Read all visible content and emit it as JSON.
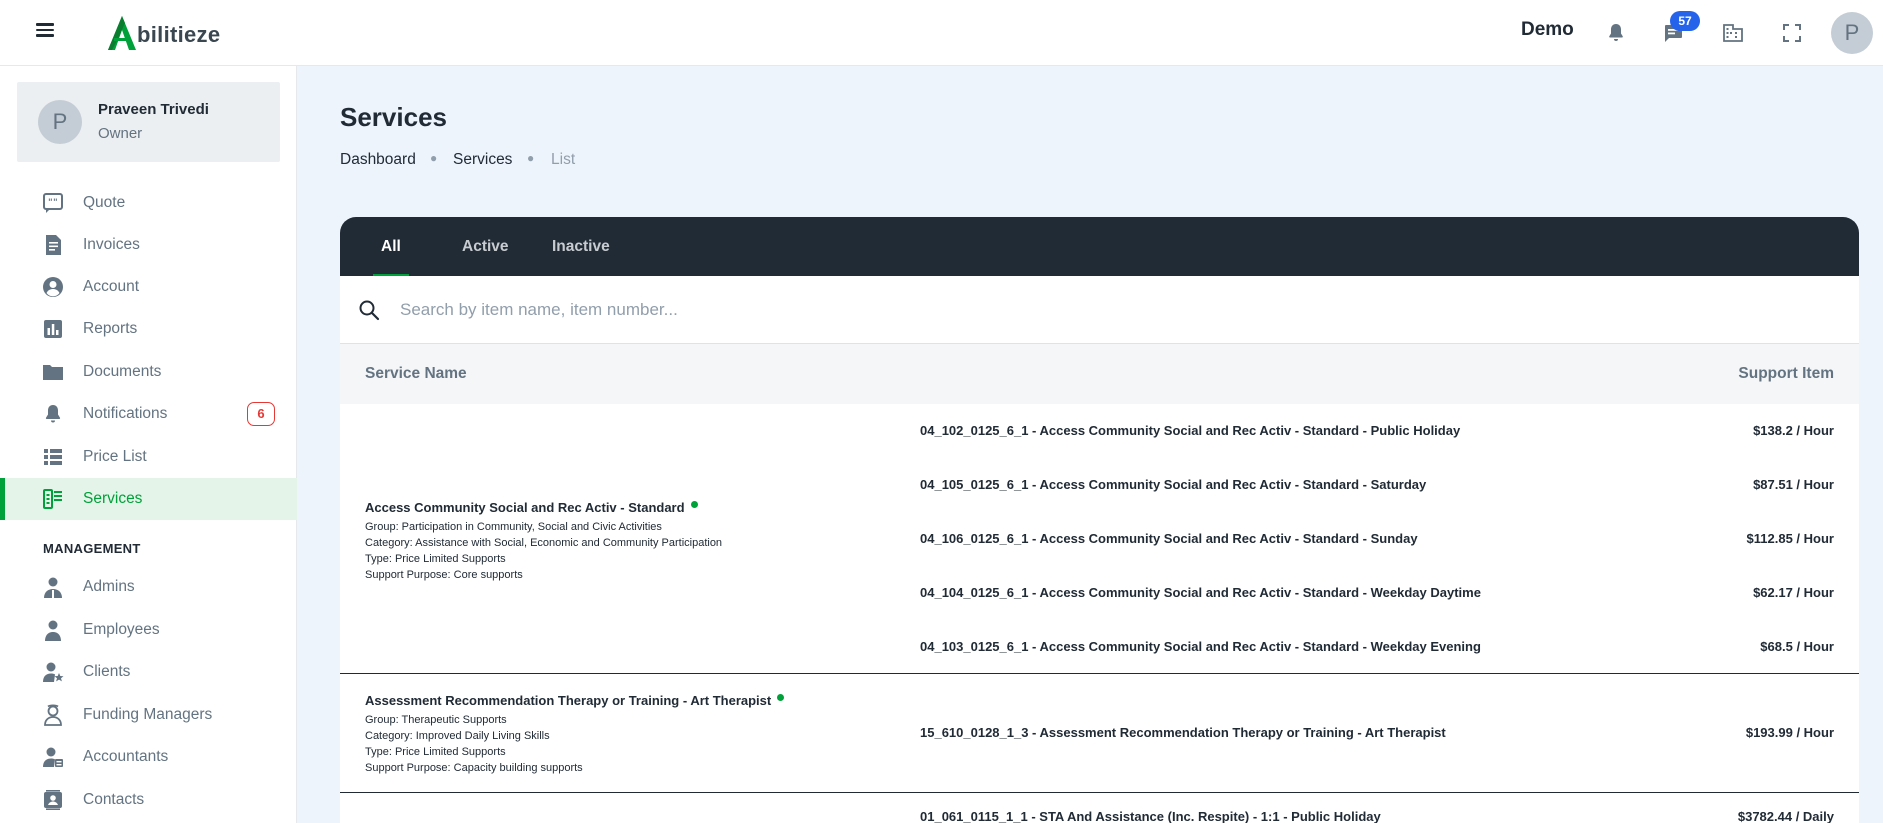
{
  "header": {
    "logo_text": "bilitieze",
    "logo_letter": "A",
    "org_name": "Demo",
    "messages_badge": "57",
    "avatar_initial": "P"
  },
  "sidebar": {
    "user": {
      "initial": "P",
      "name": "Praveen Trivedi",
      "role": "Owner"
    },
    "items": [
      {
        "label": "Quote",
        "icon": "quote-icon"
      },
      {
        "label": "Invoices",
        "icon": "invoice-icon"
      },
      {
        "label": "Account",
        "icon": "account-icon"
      },
      {
        "label": "Reports",
        "icon": "reports-icon"
      },
      {
        "label": "Documents",
        "icon": "folder-icon"
      },
      {
        "label": "Notifications",
        "icon": "bell-icon",
        "badge": "6"
      },
      {
        "label": "Price List",
        "icon": "list-icon"
      },
      {
        "label": "Services",
        "icon": "services-icon",
        "active": true
      }
    ],
    "section_title": "MANAGEMENT",
    "management_items": [
      {
        "label": "Admins",
        "icon": "admin-icon"
      },
      {
        "label": "Employees",
        "icon": "employee-icon"
      },
      {
        "label": "Clients",
        "icon": "client-icon"
      },
      {
        "label": "Funding Managers",
        "icon": "funding-manager-icon"
      },
      {
        "label": "Accountants",
        "icon": "accountant-icon"
      },
      {
        "label": "Contacts",
        "icon": "contacts-icon"
      }
    ]
  },
  "main": {
    "title": "Services",
    "breadcrumb": [
      "Dashboard",
      "Services",
      "List"
    ],
    "tabs": [
      "All",
      "Active",
      "Inactive"
    ],
    "search_placeholder": "Search by item name, item number...",
    "columns": {
      "service_name": "Service Name",
      "support_item": "Support Item"
    },
    "services": [
      {
        "name": "Access Community Social and Rec Activ - Standard",
        "group": "Group: Participation in Community, Social and Civic Activities",
        "category": "Category: Assistance with Social, Economic and Community Participation",
        "type": "Type: Price Limited Supports",
        "purpose": "Support Purpose: Core supports",
        "items": [
          {
            "name": "04_102_0125_6_1 - Access Community Social and Rec Activ - Standard - Public Holiday",
            "price": "$138.2 / Hour"
          },
          {
            "name": "04_105_0125_6_1 - Access Community Social and Rec Activ - Standard - Saturday",
            "price": "$87.51 / Hour"
          },
          {
            "name": "04_106_0125_6_1 - Access Community Social and Rec Activ - Standard - Sunday",
            "price": "$112.85 / Hour"
          },
          {
            "name": "04_104_0125_6_1 - Access Community Social and Rec Activ - Standard - Weekday Daytime",
            "price": "$62.17 / Hour"
          },
          {
            "name": "04_103_0125_6_1 - Access Community Social and Rec Activ - Standard - Weekday Evening",
            "price": "$68.5 / Hour"
          }
        ]
      },
      {
        "name": "Assessment Recommendation Therapy or Training - Art Therapist",
        "group": "Group: Therapeutic Supports",
        "category": "Category: Improved Daily Living Skills",
        "type": "Type: Price Limited Supports",
        "purpose": "Support Purpose: Capacity building supports",
        "items": [
          {
            "name": "15_610_0128_1_3 - Assessment Recommendation Therapy or Training - Art Therapist",
            "price": "$193.99 / Hour"
          }
        ]
      },
      {
        "items": [
          {
            "name": "01_061_0115_1_1 - STA And Assistance (Inc. Respite) - 1:1 - Public Holiday",
            "price": "$3782.44 / Daily"
          }
        ]
      }
    ]
  }
}
